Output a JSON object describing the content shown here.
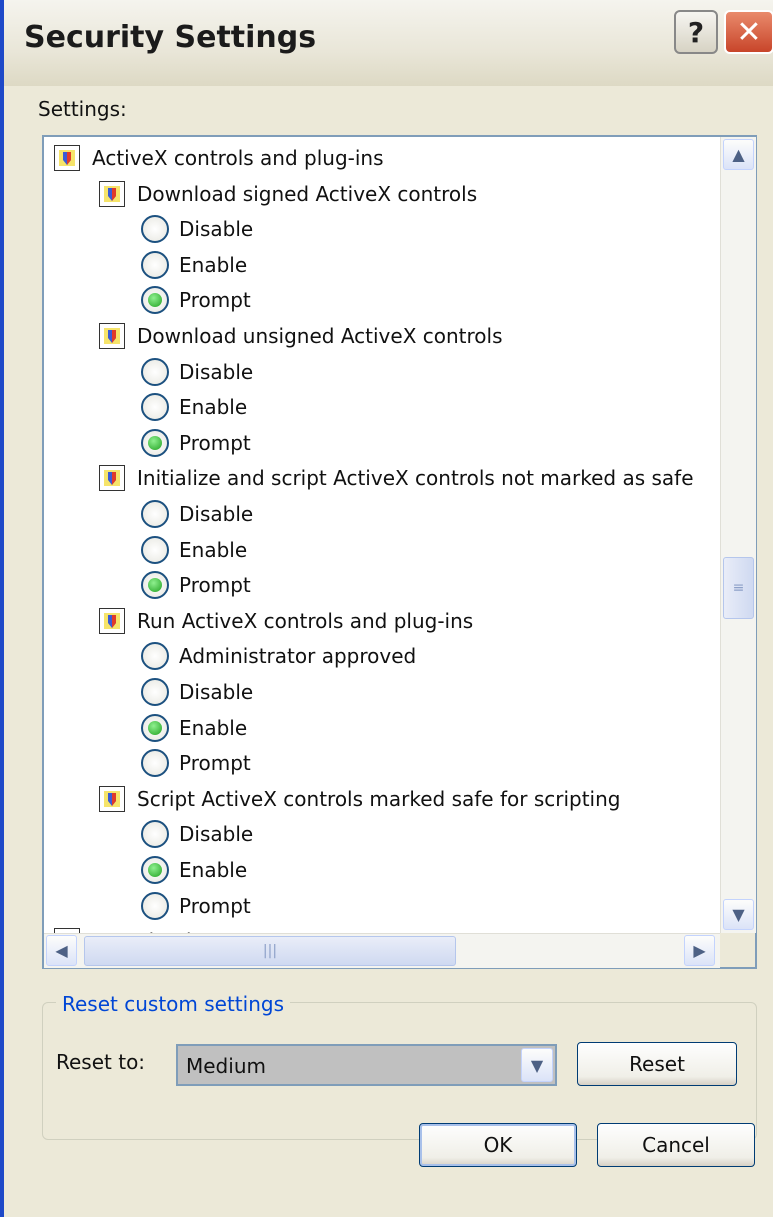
{
  "window": {
    "title": "Security Settings",
    "help_glyph": "?",
    "close_glyph": "✕"
  },
  "settings_label": "Settings:",
  "tree": {
    "root": "ActiveX controls and plug-ins",
    "groups": [
      {
        "label": "Download signed ActiveX controls",
        "options": [
          {
            "label": "Disable",
            "selected": false
          },
          {
            "label": "Enable",
            "selected": false
          },
          {
            "label": "Prompt",
            "selected": true
          }
        ]
      },
      {
        "label": "Download unsigned ActiveX controls",
        "options": [
          {
            "label": "Disable",
            "selected": false
          },
          {
            "label": "Enable",
            "selected": false
          },
          {
            "label": "Prompt",
            "selected": true
          }
        ]
      },
      {
        "label": "Initialize and script ActiveX controls not marked as safe",
        "options": [
          {
            "label": "Disable",
            "selected": false
          },
          {
            "label": "Enable",
            "selected": false
          },
          {
            "label": "Prompt",
            "selected": true
          }
        ]
      },
      {
        "label": "Run ActiveX controls and plug-ins",
        "options": [
          {
            "label": "Administrator approved",
            "selected": false
          },
          {
            "label": "Disable",
            "selected": false
          },
          {
            "label": "Enable",
            "selected": true
          },
          {
            "label": "Prompt",
            "selected": false
          }
        ]
      },
      {
        "label": "Script ActiveX controls marked safe for scripting",
        "options": [
          {
            "label": "Disable",
            "selected": false
          },
          {
            "label": "Enable",
            "selected": true
          },
          {
            "label": "Prompt",
            "selected": false
          }
        ]
      }
    ],
    "next_root": "Downloads"
  },
  "scrollbars": {
    "up": "▲",
    "down": "▼",
    "left": "◀",
    "right": "▶",
    "grip_v": "≡",
    "grip_h": "|||"
  },
  "reset_section": {
    "title": "Reset custom settings",
    "reset_to_label": "Reset to:",
    "selected_level": "Medium",
    "reset_button": "Reset"
  },
  "footer": {
    "ok": "OK",
    "cancel": "Cancel"
  },
  "colors": {
    "accent": "#0046d5",
    "selected_radio": "#21a121",
    "title_close": "#c8452a"
  }
}
